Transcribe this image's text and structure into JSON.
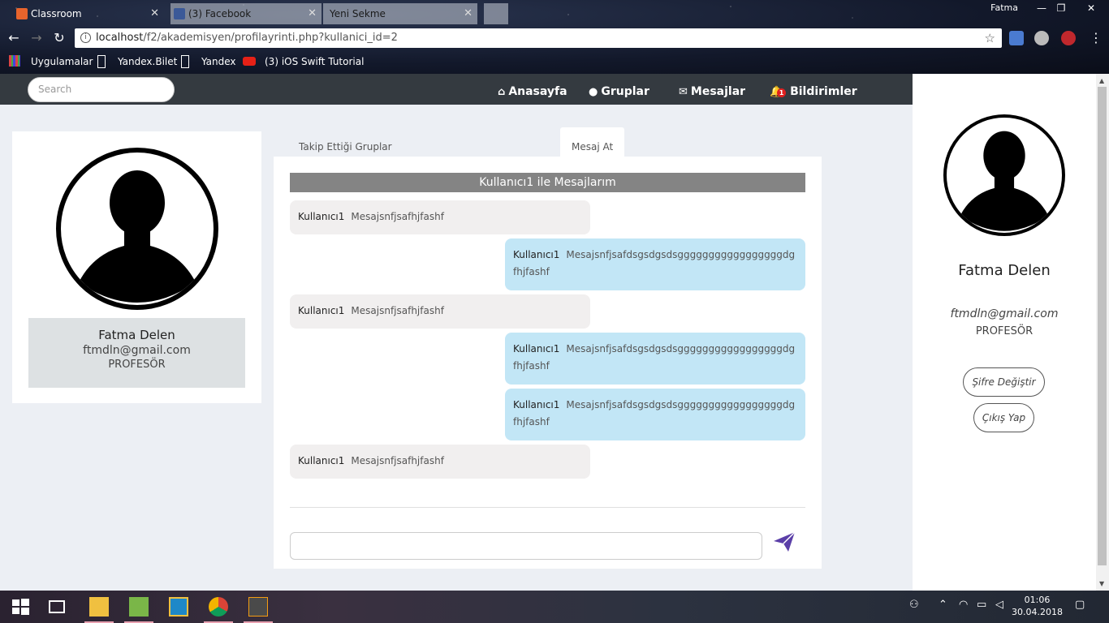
{
  "browser": {
    "tabs": [
      {
        "title": "Classroom",
        "active": true
      },
      {
        "title": "(3) Facebook",
        "active": false
      },
      {
        "title": "Yeni Sekme",
        "active": false
      }
    ],
    "user": "Fatma",
    "url_host": "localhost",
    "url_path": "/f2/akademisyen/profilayrinti.php?kullanici_id=2",
    "bookmarks": [
      "Uygulamalar",
      "Yandex.Bilet",
      "Yandex",
      "(3) iOS Swift Tutorial"
    ]
  },
  "navbar": {
    "search_placeholder": "Search",
    "items": [
      {
        "label": "Anasayfa",
        "icon": "home-icon"
      },
      {
        "label": "Gruplar",
        "icon": "users-icon"
      },
      {
        "label": "Mesajlar",
        "icon": "envelope-icon"
      },
      {
        "label": "Bildirimler",
        "icon": "bell-icon",
        "badge": "1"
      }
    ]
  },
  "profile": {
    "name": "Fatma Delen",
    "email": "ftmdln@gmail.com",
    "role": "PROFESÖR"
  },
  "tabs": {
    "groups": "Takip Ettiği Gruplar",
    "message": "Mesaj At"
  },
  "chat": {
    "header": "Kullanıcı1 ile Mesajlarım",
    "messages": [
      {
        "sender": "Kullanıcı1",
        "text": "Mesajsnfjsafhjfashf",
        "dir": "in"
      },
      {
        "sender": "Kullanıcı1",
        "text": "Mesajsnfjsafdsgsdgsdsgggggggggggggggggdgfhjfashf",
        "dir": "out"
      },
      {
        "sender": "Kullanıcı1",
        "text": "Mesajsnfjsafhjfashf",
        "dir": "in"
      },
      {
        "sender": "Kullanıcı1",
        "text": "Mesajsnfjsafdsgsdgsdsgggggggggggggggggdgfhjfashf",
        "dir": "out"
      },
      {
        "sender": "Kullanıcı1",
        "text": "Mesajsnfjsafdsgsdgsdsgggggggggggggggggdgfhjfashf",
        "dir": "out"
      },
      {
        "sender": "Kullanıcı1",
        "text": "Mesajsnfjsafhjfashf",
        "dir": "in"
      }
    ],
    "input_value": ""
  },
  "sidebar": {
    "change_password": "Şifre Değiştir",
    "logout": "Çıkış Yap"
  },
  "taskbar": {
    "time": "01:06",
    "date": "30.04.2018"
  }
}
